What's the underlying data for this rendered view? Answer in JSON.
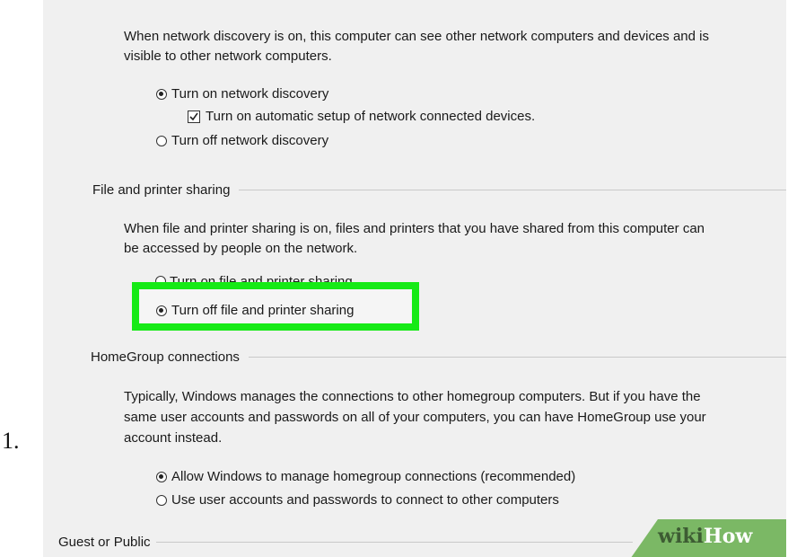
{
  "list_number": "1.",
  "network_discovery": {
    "description_line1": "When network discovery is on, this computer can see other network computers and devices and is",
    "description_line2": "visible to other network computers.",
    "option_on": "Turn on network discovery",
    "option_on_checked": true,
    "auto_setup": "Turn on automatic setup of network connected devices.",
    "auto_setup_checked": true,
    "option_off": "Turn off network discovery"
  },
  "file_printer_sharing": {
    "heading": "File and printer sharing",
    "description_line1": "When file and printer sharing is on, files and printers that you have shared from this computer can",
    "description_line2": "be accessed by people on the network.",
    "option_on": "Turn on file and printer sharing",
    "option_off": "Turn off file and printer sharing",
    "option_off_checked": true
  },
  "homegroup": {
    "heading": "HomeGroup connections",
    "description_line1": "Typically, Windows manages the connections to other homegroup computers. But if you have the",
    "description_line2": "same user accounts and passwords on all of your computers, you can have HomeGroup use your",
    "description_line3": "account instead.",
    "option_allow": "Allow Windows to manage homegroup connections (recommended)",
    "option_allow_checked": true,
    "option_use_accounts": "Use user accounts and passwords to connect to other computers"
  },
  "guest_public": {
    "heading": "Guest or Public"
  },
  "watermark": {
    "part1": "wiki",
    "part2": "How",
    "color": "#7bb865"
  },
  "colors": {
    "panel_bg": "#f0f0f0",
    "highlight_border": "#16ea16"
  }
}
